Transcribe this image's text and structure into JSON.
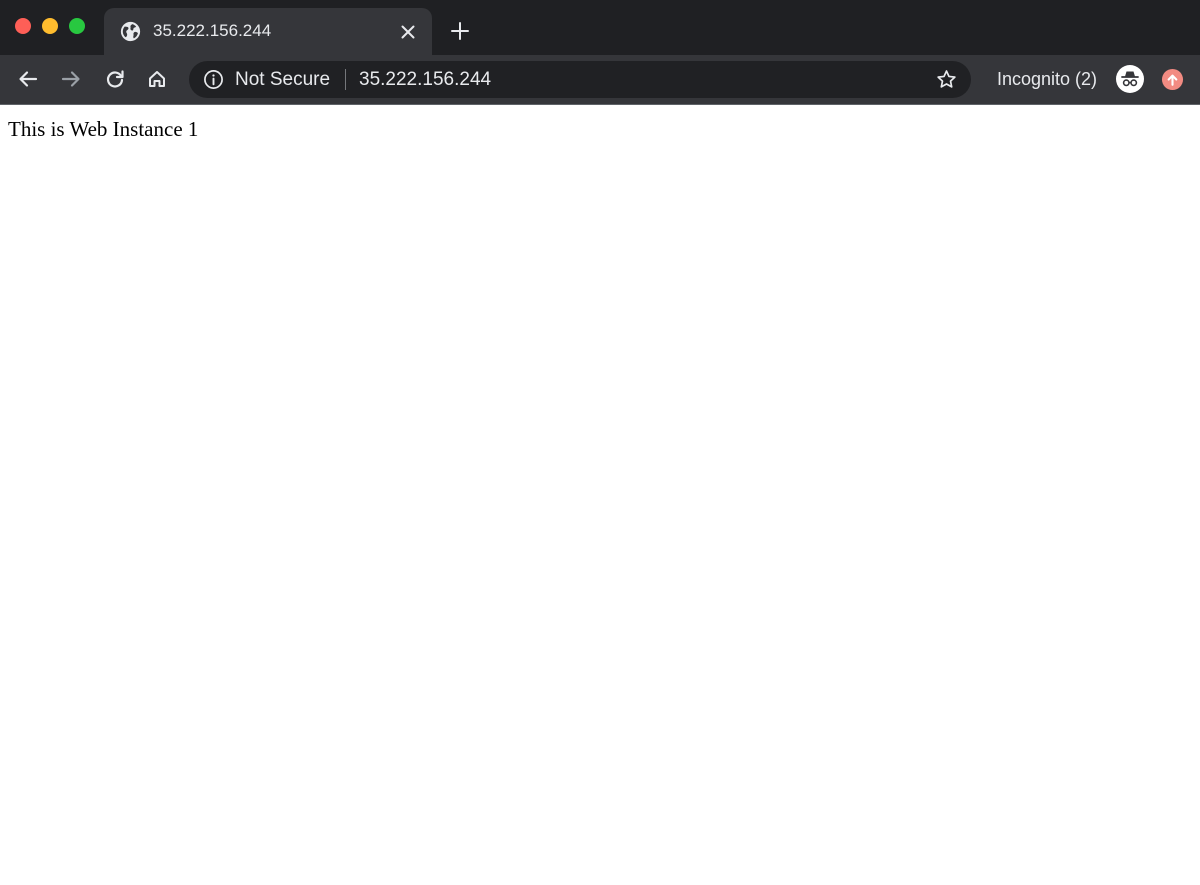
{
  "window": {
    "traffic_lights": {
      "close_color": "#fe5f57",
      "minimize_color": "#febc2e",
      "maximize_color": "#28c840"
    }
  },
  "tab": {
    "title": "35.222.156.244",
    "favicon": "globe-icon",
    "close_icon": "close-icon"
  },
  "new_tab_icon": "plus-icon",
  "toolbar": {
    "back_icon": "arrow-left-icon",
    "forward_icon": "arrow-right-icon",
    "reload_icon": "reload-icon",
    "home_icon": "home-icon"
  },
  "omnibox": {
    "security_icon": "info-icon",
    "security_label": "Not Secure",
    "url": "35.222.156.244",
    "bookmark_icon": "star-icon"
  },
  "profile": {
    "label": "Incognito (2)",
    "avatar_icon": "incognito-icon",
    "update_icon": "update-arrow-icon",
    "update_color": "#f28b82"
  },
  "page": {
    "text": "This is Web Instance 1"
  },
  "colors": {
    "tabstrip_bg": "#1f2023",
    "toolbar_bg": "#35363a",
    "omnibox_bg": "#202124",
    "text_light": "#e8eaed"
  }
}
